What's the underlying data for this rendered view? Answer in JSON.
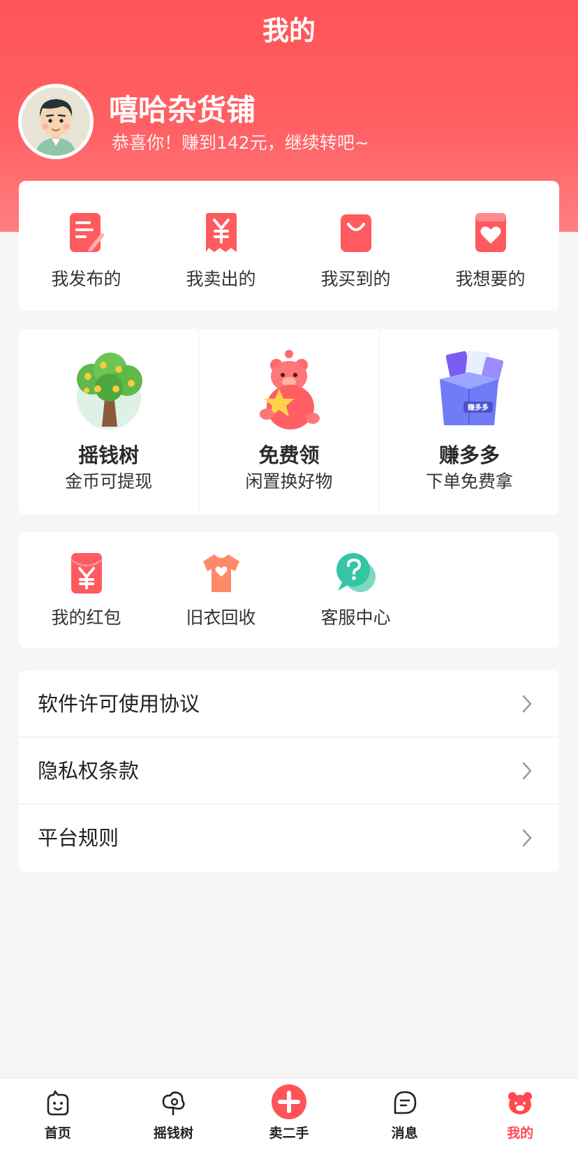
{
  "header": {
    "title": "我的",
    "username": "嘻哈杂货铺",
    "subtitle": "恭喜你！赚到142元，继续转吧~"
  },
  "quick_actions": [
    {
      "label": "我发布的",
      "icon": "document-edit-icon"
    },
    {
      "label": "我卖出的",
      "icon": "yen-receipt-icon"
    },
    {
      "label": "我买到的",
      "icon": "shopping-bag-icon"
    },
    {
      "label": "我想要的",
      "icon": "heart-card-icon"
    }
  ],
  "promos": [
    {
      "title": "摇钱树",
      "subtitle": "金币可提现",
      "icon": "money-tree-icon"
    },
    {
      "title": "免费领",
      "subtitle": "闲置换好物",
      "icon": "bear-star-icon"
    },
    {
      "title": "赚多多",
      "subtitle": "下单免费拿",
      "icon": "gift-box-icon",
      "box_text": "赚多多"
    }
  ],
  "tools": [
    {
      "label": "我的红包",
      "icon": "red-envelope-icon"
    },
    {
      "label": "旧衣回收",
      "icon": "tshirt-icon"
    },
    {
      "label": "客服中心",
      "icon": "chat-question-icon"
    }
  ],
  "menu": [
    {
      "label": "软件许可使用协议"
    },
    {
      "label": "隐私权条款"
    },
    {
      "label": "平台规则"
    }
  ],
  "tabbar": {
    "active": "我的",
    "tabs": [
      {
        "label": "首页",
        "icon": "home-face-icon"
      },
      {
        "label": "摇钱树",
        "icon": "tree-icon"
      },
      {
        "label": "卖二手",
        "icon": "plus-circle-icon"
      },
      {
        "label": "消息",
        "icon": "message-icon"
      },
      {
        "label": "我的",
        "icon": "bear-head-icon"
      }
    ]
  },
  "colors": {
    "brand": "#ff5458",
    "active_tab": "#ff4a52",
    "background": "#f6f6f7"
  }
}
